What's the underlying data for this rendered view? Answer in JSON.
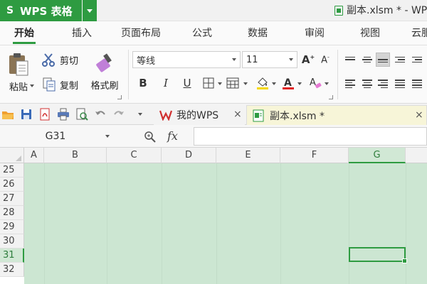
{
  "app": {
    "name": "WPS 表格",
    "logo": "S",
    "accent_color": "#2e9b41"
  },
  "window": {
    "title": "副本.xlsm * - WP"
  },
  "menu": {
    "tabs": [
      {
        "label": "开始"
      },
      {
        "label": "插入"
      },
      {
        "label": "页面布局"
      },
      {
        "label": "公式"
      },
      {
        "label": "数据"
      },
      {
        "label": "审阅"
      },
      {
        "label": "视图"
      },
      {
        "label": "云服"
      }
    ]
  },
  "ribbon": {
    "paste_label": "粘贴",
    "cut_label": "剪切",
    "copy_label": "复制",
    "format_painter_label": "格式刷",
    "font_name": "等线",
    "font_size": "11",
    "bold": "B",
    "italic": "I",
    "underline": "U"
  },
  "doc_tabs": [
    {
      "label": "我的WPS"
    },
    {
      "label": "副本.xlsm *"
    }
  ],
  "formula_bar": {
    "name_box": "G31",
    "fx_label": "fx"
  },
  "grid": {
    "columns": [
      "A",
      "B",
      "C",
      "D",
      "E",
      "F",
      "G"
    ],
    "rows": [
      "25",
      "26",
      "27",
      "28",
      "29",
      "30",
      "31",
      "32"
    ],
    "selected_column": "G",
    "selected_row": "31",
    "sheet_tint": "#cce6d2"
  }
}
